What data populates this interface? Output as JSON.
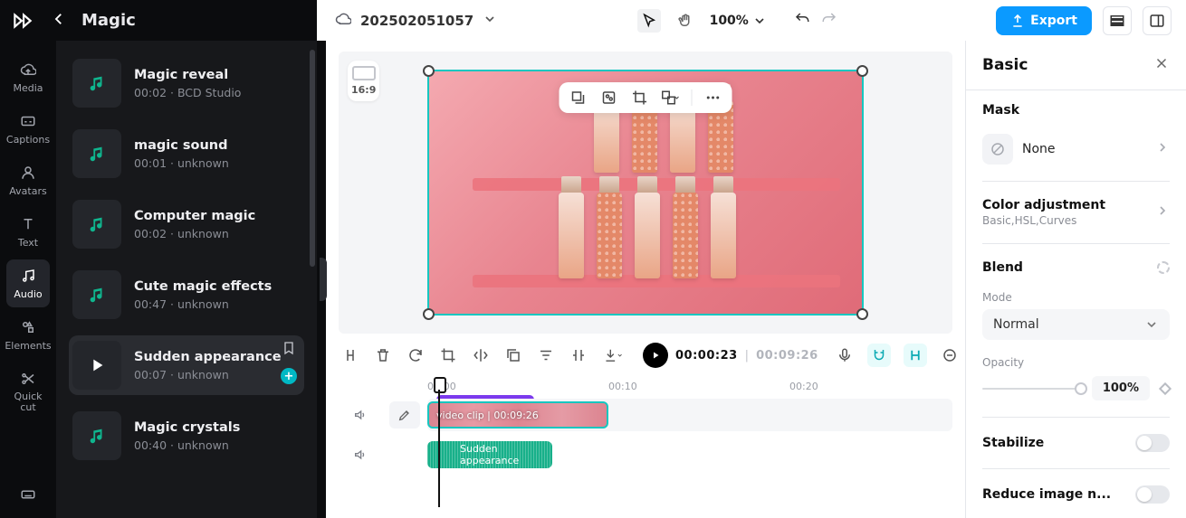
{
  "header": {
    "panel_title": "Magic",
    "project_name": "202502051057",
    "zoom": "100%",
    "export_label": "Export"
  },
  "rail": {
    "items": [
      {
        "label": "Media"
      },
      {
        "label": "Captions"
      },
      {
        "label": "Avatars"
      },
      {
        "label": "Text"
      },
      {
        "label": "Audio"
      },
      {
        "label": "Elements"
      },
      {
        "label": "Quick cut"
      }
    ]
  },
  "sounds": [
    {
      "title": "Magic reveal",
      "meta": "00:02 · BCD Studio"
    },
    {
      "title": "magic sound",
      "meta": "00:01 · unknown"
    },
    {
      "title": "Computer magic",
      "meta": "00:02 · unknown"
    },
    {
      "title": "Cute magic effects",
      "meta": "00:47 · unknown"
    },
    {
      "title": "Sudden appearance",
      "meta": "00:07 · unknown"
    },
    {
      "title": "Magic crystals",
      "meta": "00:40 · unknown"
    }
  ],
  "viewer": {
    "ratio": "16:9"
  },
  "chart_data": {
    "type": "timeline",
    "ruler_labels": [
      "00:00",
      "00:10",
      "00:20"
    ],
    "playhead_time": "00:00:23"
  },
  "timeline": {
    "current_time": "00:00:23",
    "total_time": "00:09:26",
    "ruler": [
      "00:00",
      "00:10",
      "00:20"
    ],
    "video_clip_label": "video clip | 00:09:26",
    "audio_clip_label": "Sudden appearance"
  },
  "right": {
    "title": "Basic",
    "mask_section": "Mask",
    "mask_value": "None",
    "color_section": "Color adjustment",
    "color_sub": "Basic,HSL,Curves",
    "blend_section": "Blend",
    "mode_label": "Mode",
    "mode_value": "Normal",
    "opacity_label": "Opacity",
    "opacity_value": "100%",
    "stabilize_label": "Stabilize",
    "reduce_label": "Reduce image n..."
  }
}
